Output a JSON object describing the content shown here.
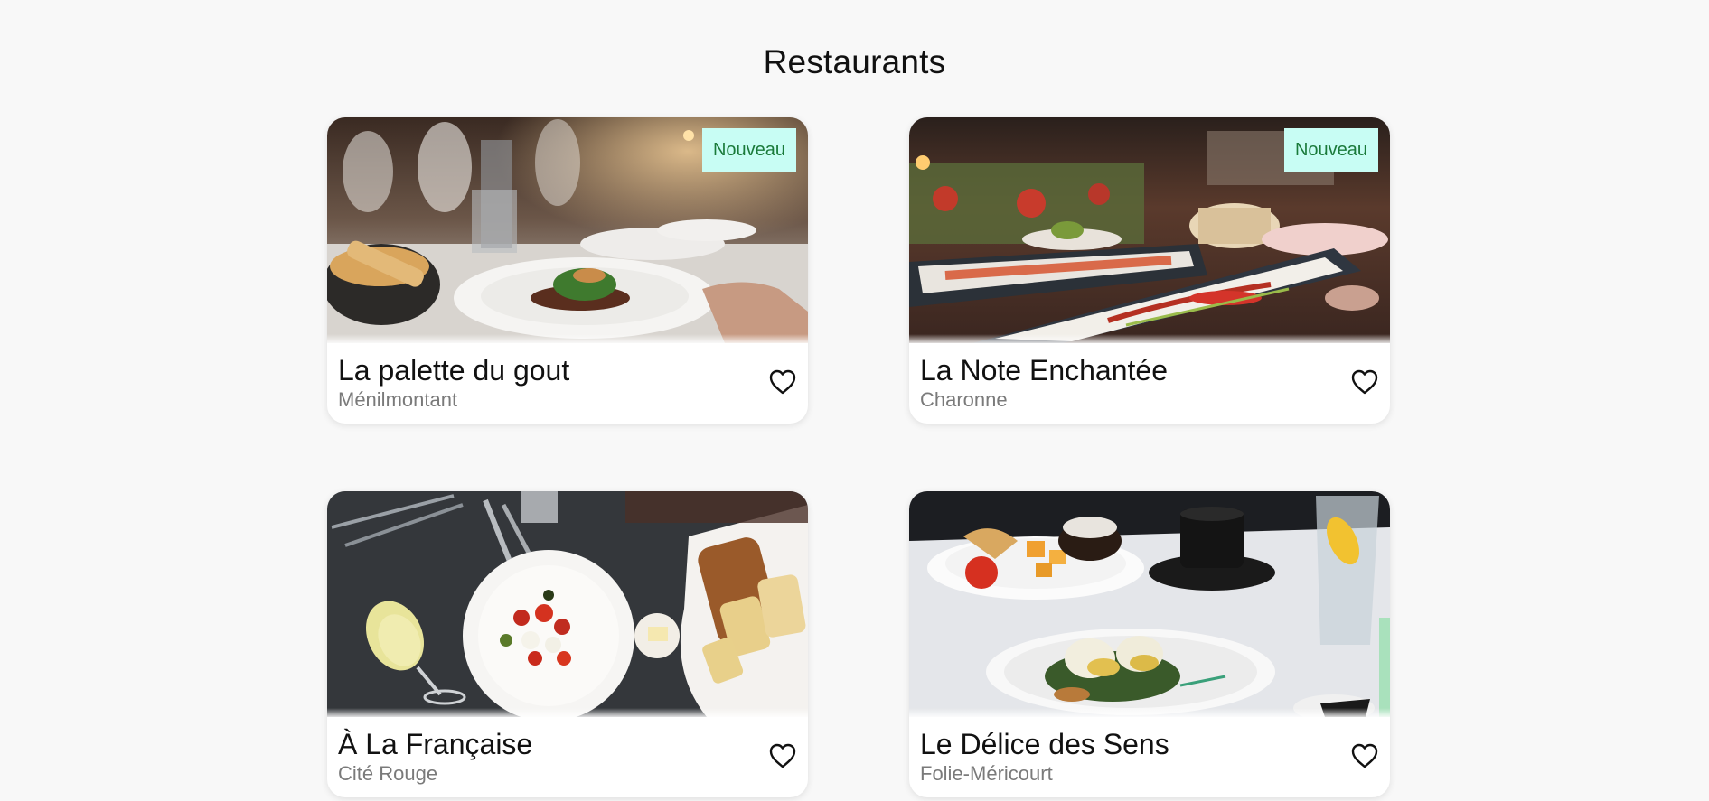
{
  "page": {
    "title": "Restaurants"
  },
  "restaurants": [
    {
      "name": "La palette du gout",
      "location": "Ménilmontant",
      "badge": "Nouveau",
      "image": "restaurant-table-photo",
      "favorite_icon": "heart-outline-icon"
    },
    {
      "name": "La Note Enchantée",
      "location": "Charonne",
      "badge": "Nouveau",
      "image": "sushi-platter-photo",
      "favorite_icon": "heart-outline-icon"
    },
    {
      "name": "À La Française",
      "location": "Cité Rouge",
      "badge": "",
      "image": "caprese-and-bread-photo",
      "favorite_icon": "heart-outline-icon"
    },
    {
      "name": "Le Délice des Sens",
      "location": "Folie-Méricourt",
      "badge": "",
      "image": "brunch-plate-photo",
      "favorite_icon": "heart-outline-icon"
    }
  ],
  "colors": {
    "background": "#f8f8f8",
    "badge_bg": "#c8fdf4",
    "badge_text": "#1a7a3a",
    "location_text": "#7a7a7a"
  }
}
